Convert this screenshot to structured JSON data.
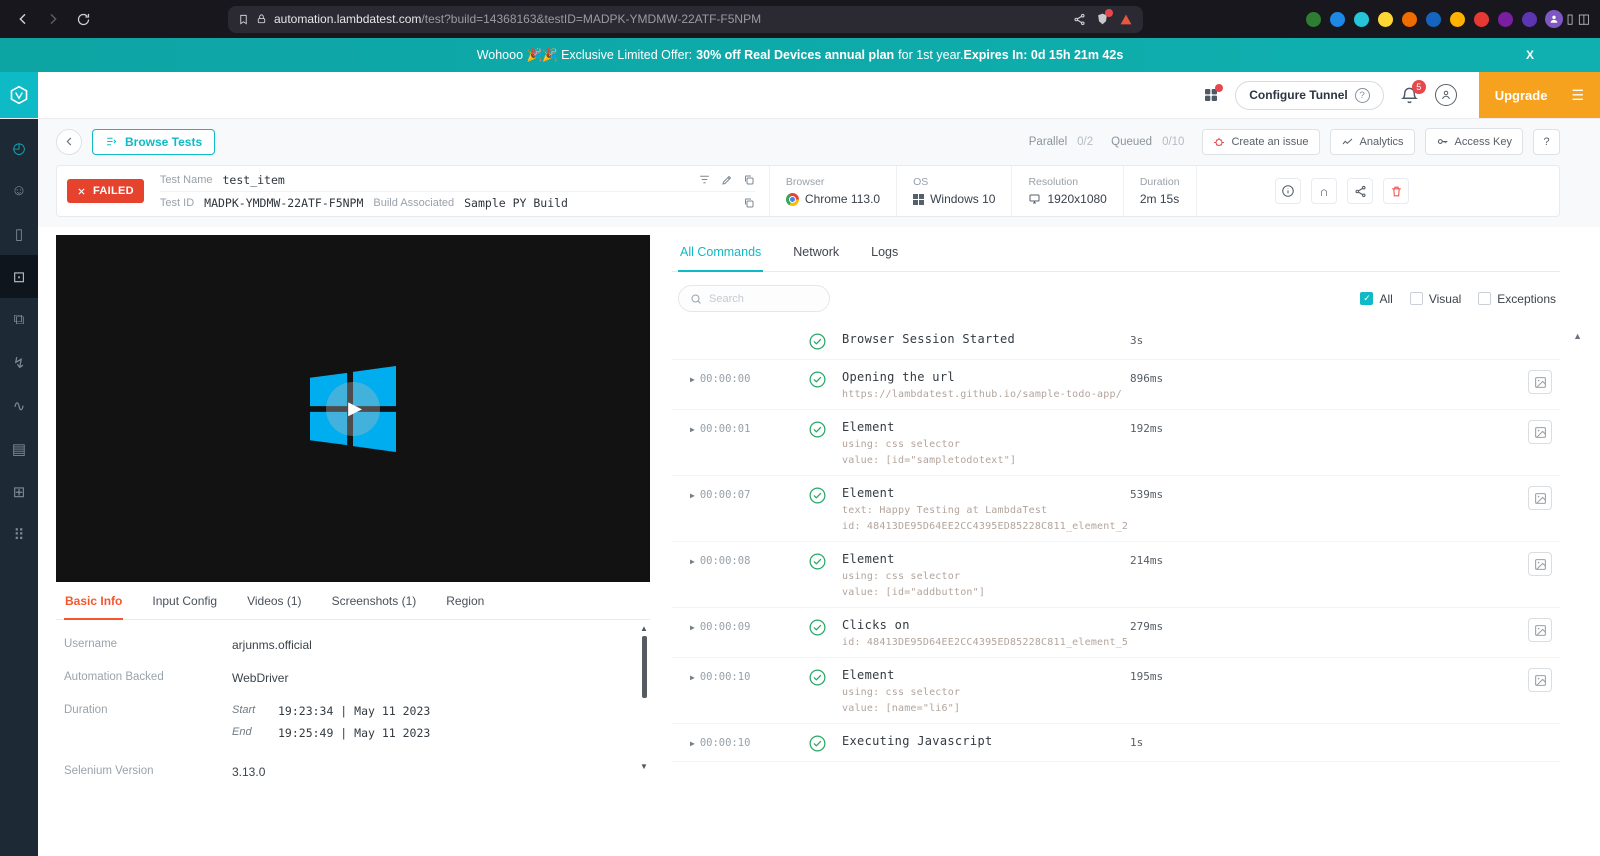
{
  "browser_chrome": {
    "url_host": "automation.lambdatest.com",
    "url_path": "/test?build=14368163&testID=MADPK-YMDMW-22ATF-F5NPM",
    "extension_colors": [
      "#2e7d32",
      "#1e88e5",
      "#26c6da",
      "#fdd835",
      "#ef6c00",
      "#1565c0",
      "#ffb300",
      "#e53935",
      "#7b1fa2",
      "#5e35b1"
    ]
  },
  "banner": {
    "text_prefix": "Wohooo 🎉🎉 Exclusive Limited Offer:",
    "text_bold": "30% off Real Devices annual plan",
    "text_suffix": "for 1st year.",
    "expires_bold": "Expires In: 0d 15h 21m 42s",
    "close_label": "X"
  },
  "header": {
    "configure_tunnel_label": "Configure Tunnel",
    "tunnel_help": "?",
    "notification_count": "5",
    "upgrade_label": "Upgrade"
  },
  "sidebar": {
    "items": [
      {
        "icon": "dashboard-gauge",
        "accent": true
      },
      {
        "icon": "status-smiley"
      },
      {
        "icon": "mobile-device"
      },
      {
        "icon": "automation-robot",
        "active": true
      },
      {
        "icon": "real-browsers"
      },
      {
        "icon": "hyperexecute-bolt"
      },
      {
        "icon": "insights-chart"
      },
      {
        "icon": "resources-docs"
      },
      {
        "icon": "integrations-plus"
      },
      {
        "icon": "apps-grid"
      }
    ]
  },
  "toolbar": {
    "browse_tests_label": "Browse Tests",
    "parallel_label": "Parallel",
    "parallel_value": "0/2",
    "queued_label": "Queued",
    "queued_value": "0/10",
    "create_issue_label": "Create an issue",
    "analytics_label": "Analytics",
    "access_key_label": "Access Key",
    "help_label": "?"
  },
  "test_info": {
    "status": "FAILED",
    "test_name_label": "Test Name",
    "test_name": "test_item",
    "test_id_label": "Test ID",
    "test_id": "MADPK-YMDMW-22ATF-F5NPM",
    "build_label": "Build Associated",
    "build": "Sample PY Build",
    "browser_label": "Browser",
    "browser": "Chrome 113.0",
    "os_label": "OS",
    "os": "Windows 10",
    "resolution_label": "Resolution",
    "resolution": "1920x1080",
    "duration_label": "Duration",
    "duration": "2m 15s"
  },
  "left_panel": {
    "tabs": [
      {
        "label": "Basic Info",
        "active": true
      },
      {
        "label": "Input Config"
      },
      {
        "label": "Videos (1)"
      },
      {
        "label": "Screenshots (1)"
      },
      {
        "label": "Region"
      }
    ],
    "fields": {
      "username_label": "Username",
      "username": "arjunms.official",
      "backend_label": "Automation Backed",
      "backend": "WebDriver",
      "duration_label": "Duration",
      "start_label": "Start",
      "start_value": "19:23:34 | May 11 2023",
      "end_label": "End",
      "end_value": "19:25:49 | May 11 2023",
      "selenium_label": "Selenium Version",
      "selenium": "3.13.0"
    }
  },
  "commands_panel": {
    "tabs": [
      {
        "label": "All Commands",
        "active": true
      },
      {
        "label": "Network"
      },
      {
        "label": "Logs"
      }
    ],
    "search_placeholder": "Search",
    "filters": [
      {
        "label": "All",
        "checked": true
      },
      {
        "label": "Visual",
        "checked": false
      },
      {
        "label": "Exceptions",
        "checked": false
      }
    ],
    "rows": [
      {
        "time": "",
        "title": "Browser Session Started",
        "lines": [],
        "duration": "3s",
        "has_screenshot": false
      },
      {
        "time": "00:00:00",
        "title": "Opening the url",
        "lines": [
          "https://lambdatest.github.io/sample-todo-app/"
        ],
        "duration": "896ms",
        "has_screenshot": true
      },
      {
        "time": "00:00:01",
        "title": "Element",
        "lines": [
          "using: css selector",
          "value: [id=\"sampletodotext\"]"
        ],
        "duration": "192ms",
        "has_screenshot": true
      },
      {
        "time": "00:00:07",
        "title": "Element",
        "lines": [
          "text: Happy Testing at LambdaTest",
          "id: 48413DE95D64EE2CC4395ED85228C811_element_2"
        ],
        "duration": "539ms",
        "has_screenshot": true
      },
      {
        "time": "00:00:08",
        "title": "Element",
        "lines": [
          "using: css selector",
          "value: [id=\"addbutton\"]"
        ],
        "duration": "214ms",
        "has_screenshot": true
      },
      {
        "time": "00:00:09",
        "title": "Clicks on",
        "lines": [
          "id: 48413DE95D64EE2CC4395ED85228C811_element_5"
        ],
        "duration": "279ms",
        "has_screenshot": true
      },
      {
        "time": "00:00:10",
        "title": "Element",
        "lines": [
          "using: css selector",
          "value: [name=\"li6\"]"
        ],
        "duration": "195ms",
        "has_screenshot": true
      },
      {
        "time": "00:00:10",
        "title": "Executing Javascript",
        "lines": [],
        "duration": "1s",
        "has_screenshot": false
      }
    ]
  },
  "colors": {
    "accent_teal": "#0ebac5",
    "banner_teal": "#0da4a4",
    "upgrade_orange": "#f6a21e",
    "failed_red": "#e5432e",
    "success_green": "#27a567",
    "active_tab_orange": "#f4562e",
    "sidebar_bg": "#1d2935"
  }
}
